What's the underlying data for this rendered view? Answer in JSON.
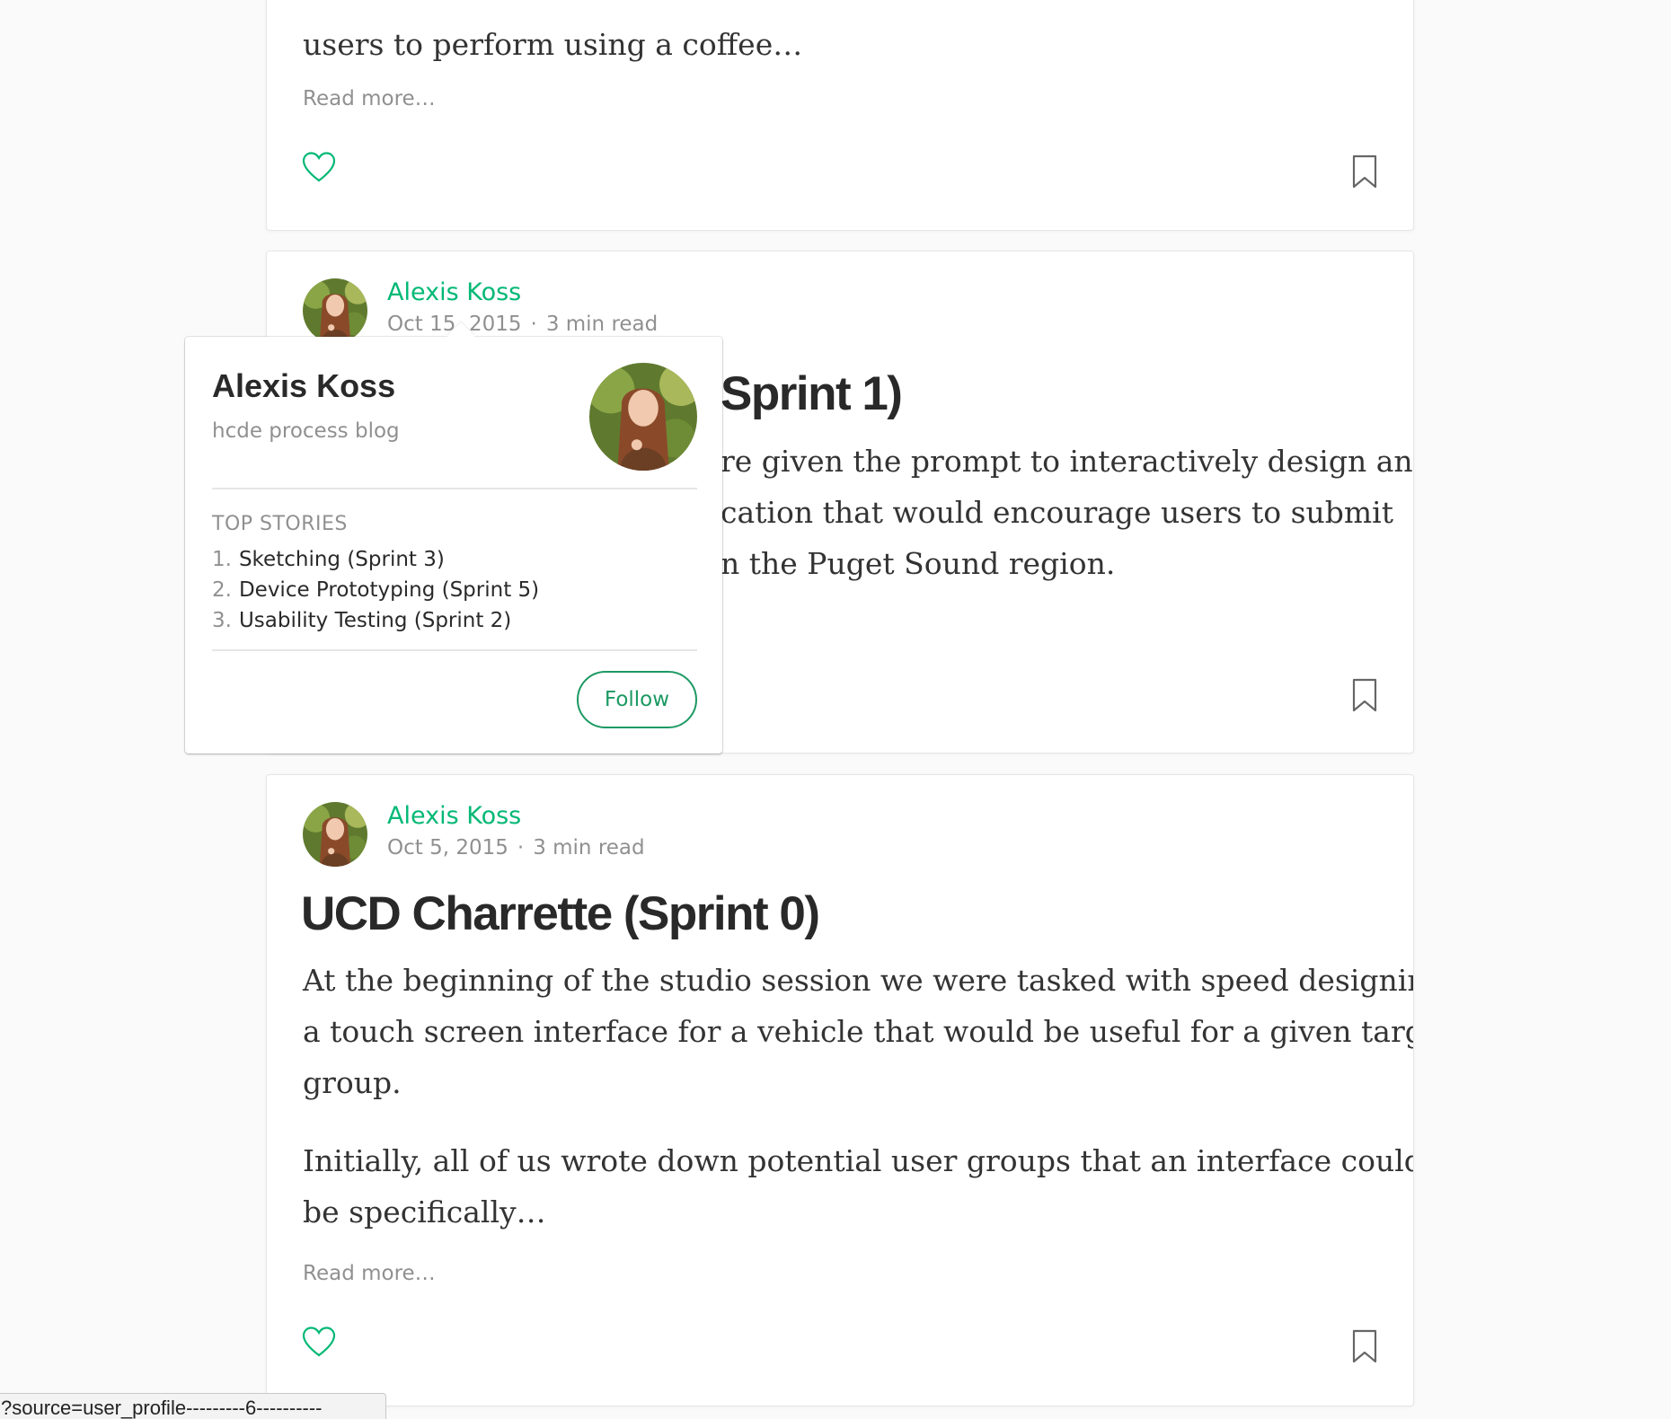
{
  "colors": {
    "accent": "#02b875",
    "follow": "#1c9963",
    "text": "#333333",
    "muted": "#999999"
  },
  "card1": {
    "excerpt_line": "users to perform using a coffee…",
    "read_more": "Read more…",
    "icons": [
      "heart-icon",
      "bookmark-icon"
    ]
  },
  "card2": {
    "author": "Alexis Koss",
    "date": "Oct 15, 2015",
    "dot": "·",
    "read_time": "3 min read",
    "title_visible": "Sprint 1)",
    "excerpt_lines": [
      "re given the prompt to interactively design and",
      "cation that would encourage users to submit",
      "n the Puget Sound region."
    ],
    "icons": [
      "bookmark-icon"
    ]
  },
  "popover": {
    "name": "Alexis Koss",
    "publication": "hcde process blog",
    "top_stories_label": "TOP STORIES",
    "top_stories": [
      {
        "num": "1.",
        "title": "Sketching (Sprint 3)"
      },
      {
        "num": "2.",
        "title": "Device Prototyping (Sprint 5)"
      },
      {
        "num": "3.",
        "title": "Usability Testing (Sprint 2)"
      }
    ],
    "follow_label": "Follow"
  },
  "card3": {
    "author": "Alexis Koss",
    "date": "Oct 5, 2015",
    "dot": "·",
    "read_time": "3 min read",
    "title": "UCD Charrette (Sprint 0)",
    "paragraph1_lines": [
      "At the beginning of the studio session we were tasked with speed designing",
      "a touch screen interface for a vehicle that would be useful for a given target",
      "group."
    ],
    "paragraph2_lines": [
      "Initially, all of us wrote down potential user groups that an interface could",
      "be specifically…"
    ],
    "read_more": "Read more…",
    "icons": [
      "heart-icon",
      "bookmark-icon"
    ]
  },
  "status_bar": {
    "url": "?source=user_profile---------6----------"
  }
}
